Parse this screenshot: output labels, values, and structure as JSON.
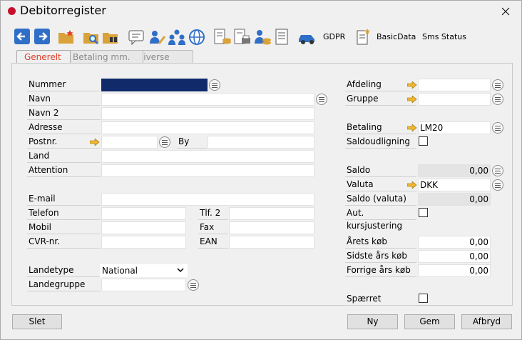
{
  "window": {
    "title": "Debitorregister",
    "close_glyph": "✕"
  },
  "toolbar": {
    "gdpr_label": "GDPR",
    "basicdata_label": "BasicData",
    "smsstatus_label": "Sms Status"
  },
  "tabs": [
    {
      "label": "Generelt"
    },
    {
      "label": "Betaling mm."
    },
    {
      "label": "Diverse"
    }
  ],
  "left": {
    "nummer_label": "Nummer",
    "nummer_value": "",
    "navn_label": "Navn",
    "navn2_label": "Navn 2",
    "adresse_label": "Adresse",
    "postnr_label": "Postnr.",
    "by_label": "By",
    "land_label": "Land",
    "attention_label": "Attention",
    "email_label": "E-mail",
    "telefon_label": "Telefon",
    "tlf2_label": "Tlf. 2",
    "mobil_label": "Mobil",
    "fax_label": "Fax",
    "cvr_label": "CVR-nr.",
    "ean_label": "EAN",
    "landetype_label": "Landetype",
    "landetype_value": "National",
    "landegruppe_label": "Landegruppe"
  },
  "right": {
    "afdeling_label": "Afdeling",
    "gruppe_label": "Gruppe",
    "betaling_label": "Betaling",
    "betaling_value": "LM20",
    "saldoudligning_label": "Saldoudligning",
    "saldo_label": "Saldo",
    "saldo_value": "0,00",
    "valuta_label": "Valuta",
    "valuta_value": "DKK",
    "saldo_valuta_label": "Saldo (valuta)",
    "saldo_valuta_value": "0,00",
    "aut_label": "Aut. kursjustering",
    "aarets_koeb_label": "Årets køb",
    "aarets_koeb_value": "0,00",
    "sidste_aars_label": "Sidste års køb",
    "sidste_aars_value": "0,00",
    "forrige_aars_label": "Forrige års køb",
    "forrige_aars_value": "0,00",
    "spaerret_label": "Spærret"
  },
  "buttons": {
    "slet": "Slet",
    "ny": "Ny",
    "gem": "Gem",
    "afbryd": "Afbryd"
  },
  "colors": {
    "accent_tab": "#e0402a",
    "selected_field": "#102a6a",
    "title_dot": "#c8102e",
    "nav_blue": "#2f6fc7"
  }
}
